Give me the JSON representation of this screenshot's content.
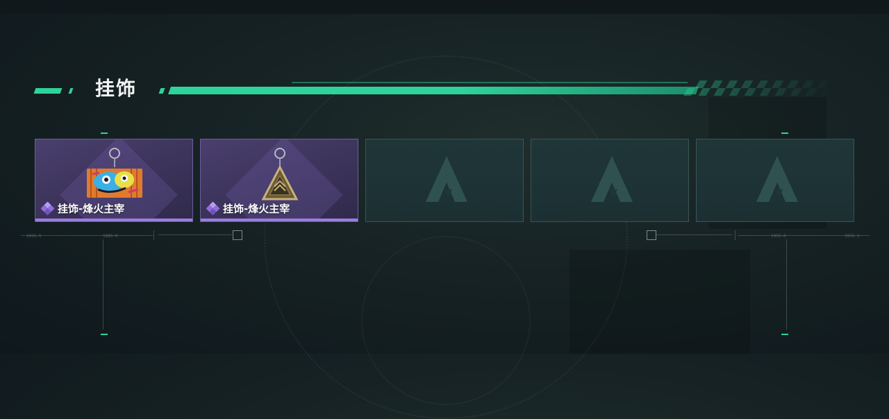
{
  "section": {
    "title": "挂饰"
  },
  "slots": [
    {
      "state": "filled",
      "name": "挂饰-烽火主宰",
      "item_icon": "graffiti-box-charm-icon",
      "rarity_icon": "purple-diamond-icon"
    },
    {
      "state": "filled",
      "name": "挂饰-烽火主宰",
      "item_icon": "triangle-pendant-charm-icon",
      "rarity_icon": "purple-diamond-icon"
    },
    {
      "state": "empty",
      "placeholder_icon": "a-emblem-icon"
    },
    {
      "state": "empty",
      "placeholder_icon": "a-emblem-icon"
    },
    {
      "state": "empty",
      "placeholder_icon": "a-emblem-icon"
    }
  ],
  "deco_labels": [
    "2035-5",
    "1985-0",
    "1955-0",
    "2035-1"
  ],
  "colors": {
    "accent": "#2ed39a",
    "rare_purple": "#9a7de0",
    "empty_slot": "#1f3638"
  }
}
